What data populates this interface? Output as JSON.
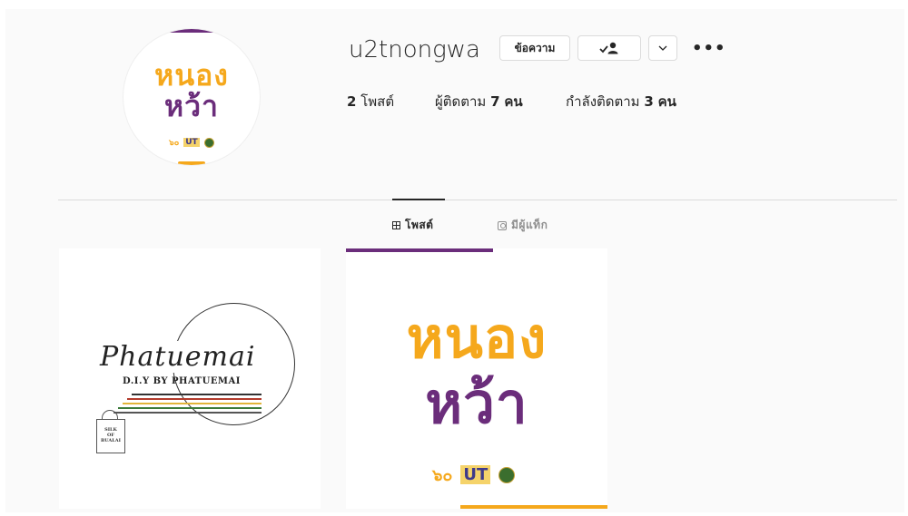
{
  "profile": {
    "username": "u2tnongwa",
    "avatar_logo": {
      "line1": "หนอง",
      "line2": "หว้า",
      "mini_a": "๖๐",
      "mini_b": "UT"
    }
  },
  "actions": {
    "message_label": "ข้อความ",
    "follow_icon": "person-check-icon",
    "more_icon": "chevron-down-icon",
    "options_icon": "ellipsis-icon",
    "options_text": "•••"
  },
  "stats": {
    "posts": {
      "value": "2",
      "label": "โพสต์"
    },
    "followers": {
      "label": "ผู้ติดตาม",
      "value": "7",
      "unit": "คน"
    },
    "following": {
      "label": "กำลังติดตาม",
      "value": "3",
      "unit": "คน"
    }
  },
  "tabs": [
    {
      "label": "โพสต์",
      "icon": "grid-icon",
      "active": true
    },
    {
      "label": "มีผู้แท็ก",
      "icon": "tag-icon",
      "active": false
    }
  ],
  "posts": [
    {
      "script": "Phatuemai",
      "subtitle": "D.I.Y BY PHATUEMAI",
      "bag_text": [
        "SILK",
        "OF",
        "BUALAI"
      ]
    },
    {
      "line1": "หนอง",
      "line2": "หว้า",
      "mini_a": "๖๐",
      "mini_b": "UT"
    }
  ],
  "colors": {
    "brand_orange": "#f5a81c",
    "brand_purple": "#6b2d7b",
    "text": "#262626",
    "muted": "#8e8e8e",
    "border": "#dbdbdb"
  }
}
